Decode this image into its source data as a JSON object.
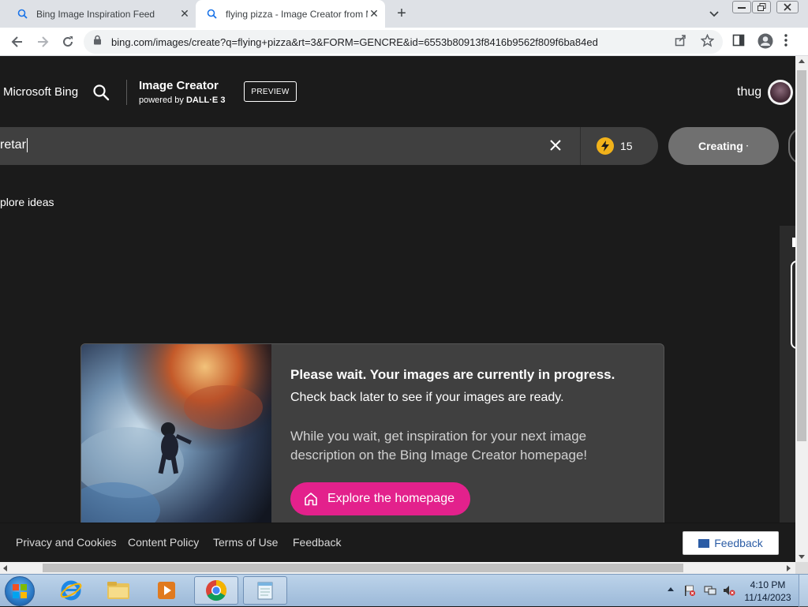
{
  "browser": {
    "tabs": [
      {
        "title": "Bing Image Inspiration Feed",
        "active": false
      },
      {
        "title": "flying pizza - Image Creator from Microsoft Bing",
        "active": true
      }
    ],
    "url": "bing.com/images/create?q=flying+pizza&rt=3&FORM=GENCRE&id=6553b80913f8416b9562f809f6ba84ed"
  },
  "header": {
    "brand": "Microsoft Bing",
    "product_title": "Image Creator",
    "powered_by": "powered by",
    "powered_model": "DALL·E 3",
    "badge": "PREVIEW",
    "username": "thug"
  },
  "prompt": {
    "value": "retar",
    "boost_count": "15",
    "submit_label": "Creating"
  },
  "explore_ideas_label": "plore ideas",
  "wait_card": {
    "title": "Please wait. Your images are currently in progress.",
    "subtitle": "Check back later to see if your images are ready.",
    "body": "While you wait, get inspiration for your next image description on the Bing Image Creator homepage!",
    "button_label": "Explore the homepage"
  },
  "footer": {
    "links": [
      "Privacy and Cookies",
      "Content Policy",
      "Terms of Use",
      "Feedback"
    ],
    "feedback_button": "Feedback"
  },
  "taskbar": {
    "time": "4:10 PM",
    "date": "11/14/2023"
  },
  "colors": {
    "page_bg": "#1b1b1b",
    "accent_pink": "#e3218c",
    "boost_gold": "#f1b21a",
    "card_bg": "#404040"
  }
}
